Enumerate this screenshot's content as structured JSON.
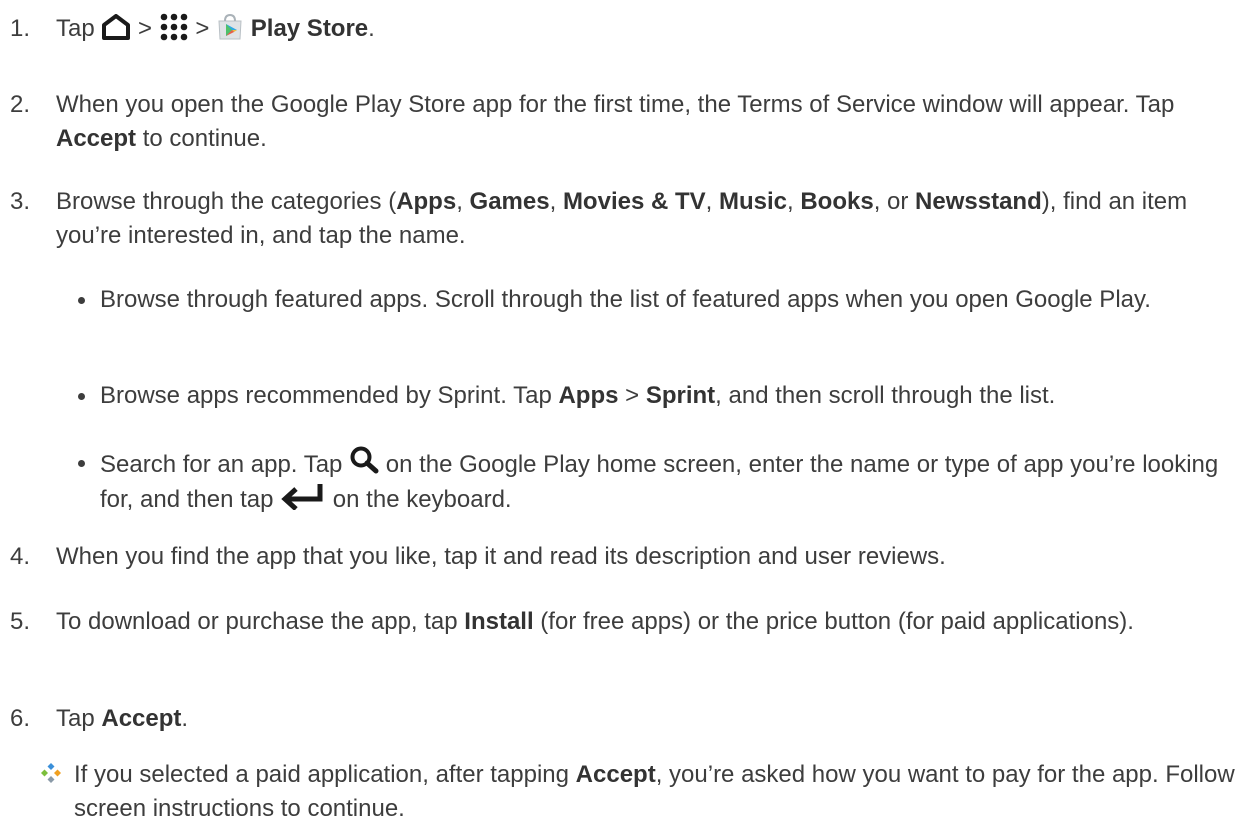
{
  "steps": [
    {
      "number": "1.",
      "tap": "Tap",
      "sep1": ">",
      "sep2": ">",
      "play_store": "Play Store",
      "end": "."
    },
    {
      "number": "2.",
      "text_a": "When you open the Google Play Store app for the first time, the Terms of Service window will appear. Tap ",
      "accept": "Accept",
      "text_b": " to continue."
    },
    {
      "number": "3.",
      "text_a": "Browse through the categories (",
      "apps": "Apps",
      "comma1": ", ",
      "games": "Games",
      "comma2": ", ",
      "movies": "Movies & TV",
      "comma3": ", ",
      "music": "Music",
      "comma4": ", ",
      "books": "Books",
      "comma5": ", or ",
      "newsstand": "Newsstand",
      "text_b": "), find an item you’re interested in, and tap the name."
    },
    {
      "number": "4.",
      "text": "When you find the app that you like, tap it and read its description and user reviews."
    },
    {
      "number": "5.",
      "text_a": "To download or purchase the app, tap ",
      "install": "Install",
      "text_b": " (for free apps) or the price button (for paid applications)."
    },
    {
      "number": "6.",
      "text_a": "Tap ",
      "accept": "Accept",
      "text_b": "."
    }
  ],
  "bullets": [
    {
      "text": "Browse through featured apps. Scroll through the list of featured apps when you open Google Play."
    },
    {
      "text_a": "Browse apps recommended by Sprint. Tap ",
      "apps": "Apps",
      "sep": " > ",
      "sprint": "Sprint",
      "text_b": ", and then scroll through the list."
    },
    {
      "text_a": "Search for an app. Tap ",
      "text_b": " on the Google Play home screen, enter the name or type of app you’re looking for, and then tap ",
      "text_c": " on the keyboard."
    }
  ],
  "note": {
    "text_a": "If you selected a paid application, after tapping ",
    "accept": "Accept",
    "text_b": ", you’re asked how you want to pay for the app. Follow screen instructions to continue."
  },
  "icons": {
    "home": "home-icon",
    "apps": "apps-grid-icon",
    "play_store": "play-store-icon",
    "search": "search-icon",
    "enter": "enter-key-icon",
    "note": "note-diamond-icon"
  }
}
